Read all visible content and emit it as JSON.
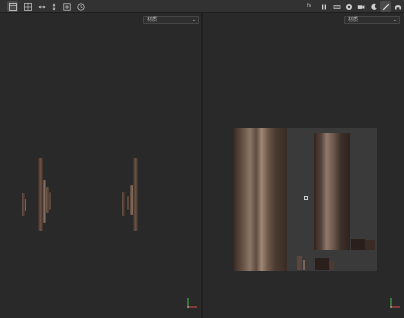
{
  "toolbar": {
    "left_icons": [
      {
        "name": "viewport-single-icon",
        "active": true
      },
      {
        "name": "grid-icon",
        "active": false
      },
      {
        "name": "move-horizontal-icon",
        "active": false
      },
      {
        "name": "move-vertical-icon",
        "active": false
      },
      {
        "name": "add-icon",
        "active": false
      },
      {
        "name": "history-icon",
        "active": false
      }
    ],
    "right_icons": [
      {
        "name": "fps-label",
        "active": false
      },
      {
        "name": "pause-icon",
        "active": false
      },
      {
        "name": "light-icon",
        "active": false
      },
      {
        "name": "environment-icon",
        "active": false
      },
      {
        "name": "camera-icon",
        "active": false
      },
      {
        "name": "night-mode-icon",
        "active": false
      },
      {
        "name": "brush-icon",
        "active": true
      },
      {
        "name": "settings-icon",
        "active": false
      }
    ],
    "fps_text": "fs"
  },
  "left_viewport": {
    "dropdown_value": "材质"
  },
  "right_viewport": {
    "dropdown_value": "材质"
  },
  "colors": {
    "background": "#292929",
    "toolbar": "#323232",
    "wood_dark": "#3e2f29",
    "wood_mid": "#5a463c",
    "wood_light": "#8a7466",
    "axis_x": "#e04a4a",
    "axis_y": "#4ac04a"
  }
}
